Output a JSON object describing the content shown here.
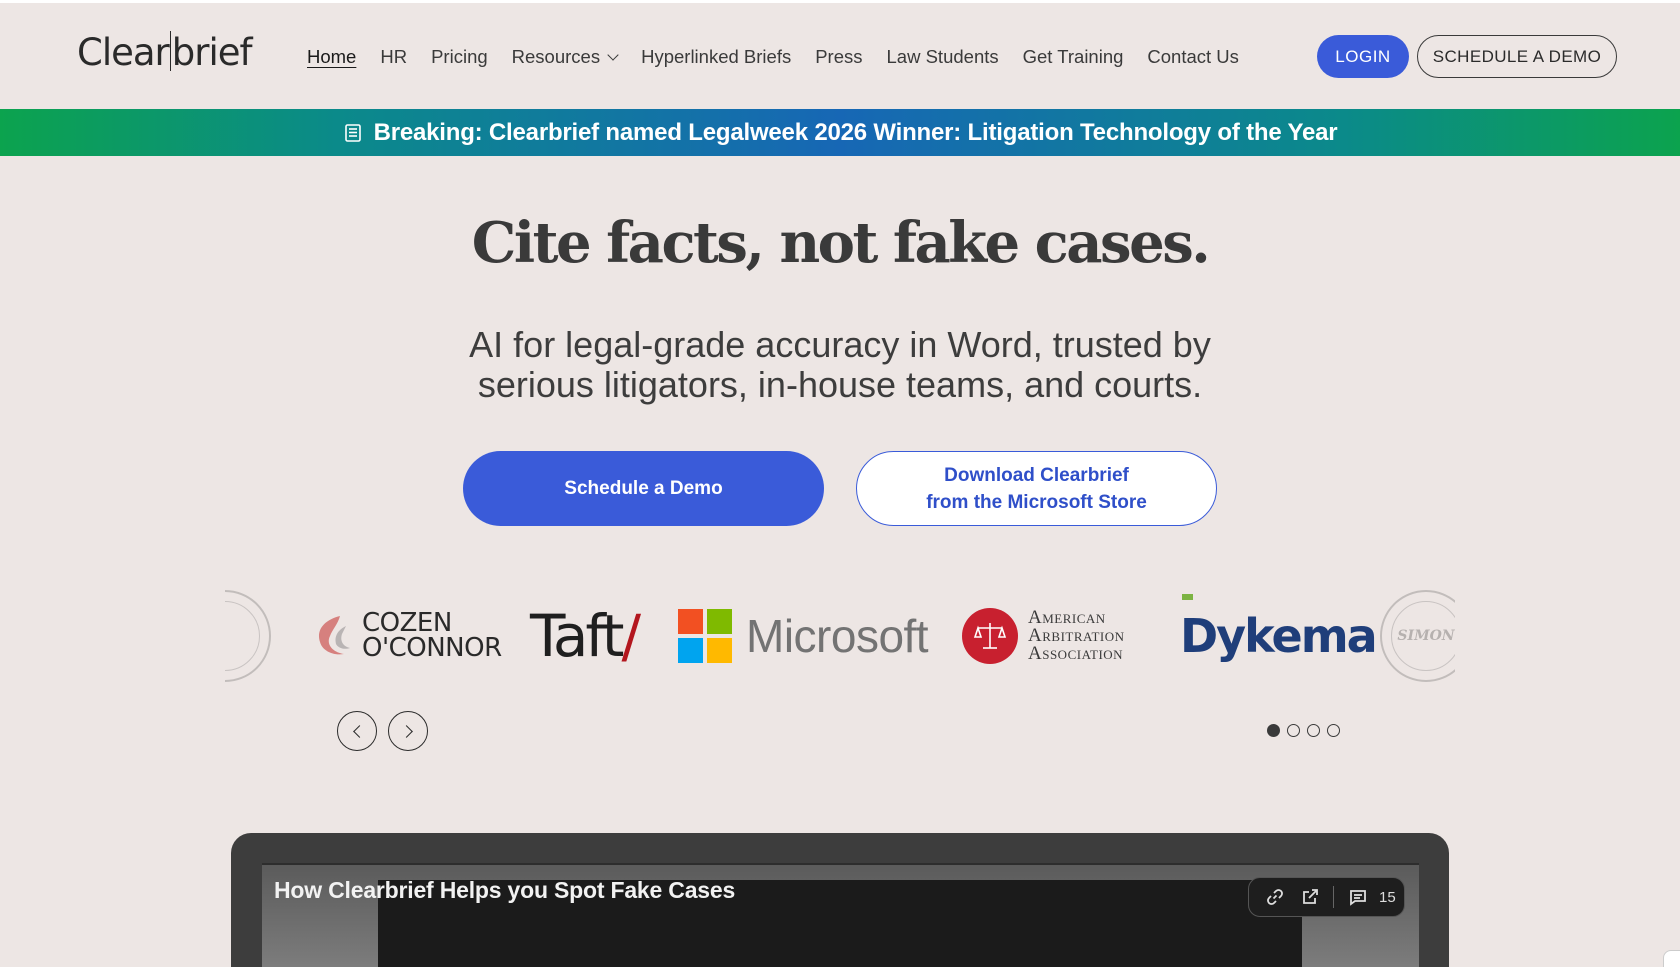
{
  "brand": {
    "logo_left": "Clear",
    "logo_right": "brief"
  },
  "nav": {
    "items": [
      {
        "label": "Home",
        "active": true
      },
      {
        "label": "HR"
      },
      {
        "label": "Pricing"
      },
      {
        "label": "Resources",
        "has_dropdown": true
      },
      {
        "label": "Hyperlinked Briefs"
      },
      {
        "label": "Press"
      },
      {
        "label": "Law Students"
      },
      {
        "label": "Get Training"
      },
      {
        "label": "Contact Us"
      }
    ],
    "login_label": "LOGIN",
    "schedule_label": "SCHEDULE A DEMO"
  },
  "banner": {
    "text": "Breaking: Clearbrief named Legalweek 2026 Winner: Litigation Technology of the Year",
    "icon": "newspaper-icon"
  },
  "hero": {
    "headline": "Cite facts, not fake cases.",
    "subhead_line1": "AI for legal-grade accuracy in Word, trusted by",
    "subhead_line2": "serious litigators, in-house teams, and courts.",
    "cta_primary": "Schedule a Demo",
    "cta_secondary_line1": "Download Clearbrief",
    "cta_secondary_line2": "from the Microsoft Store"
  },
  "logos": {
    "cozen_line1": "COZEN",
    "cozen_line2": "O'CONNOR",
    "taft": "Taft",
    "taft_slash": "/",
    "microsoft": "Microsoft",
    "aaa_line1": "American",
    "aaa_line2": "Arbitration",
    "aaa_line3": "Association",
    "dykema": "Dykema",
    "seal_right": "SIMON"
  },
  "carousel": {
    "dot_count": 4,
    "active_dot": 0
  },
  "video": {
    "title": "How Clearbrief Helps you Spot Fake Cases",
    "comment_count": "15"
  },
  "colors": {
    "accent": "#3a5bd9",
    "banner_green": "#0ca34e",
    "banner_blue": "#1767b5",
    "background": "#ede6e4"
  }
}
